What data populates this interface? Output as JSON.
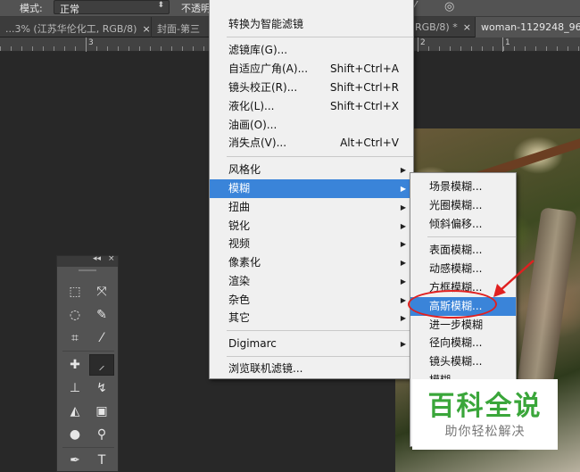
{
  "options_bar": {
    "mode_label": "模式:",
    "mode_value": "正常",
    "opacity_label": "不透明"
  },
  "tabs": [
    {
      "label": "...3% (江苏华伦化工, RGB/8)",
      "close": "×"
    },
    {
      "label": "封面-第三",
      "close": ""
    },
    {
      "label": "RGB/8) *",
      "close": "×"
    },
    {
      "label": "woman-1129248_96",
      "close": ""
    }
  ],
  "ruler": {
    "numbers": [
      "3",
      "2",
      "1"
    ]
  },
  "filter_menu": {
    "items": [
      {
        "label": "转换为智能滤镜",
        "shortcut": "",
        "submenu": false
      },
      {
        "label": "滤镜库(G)...",
        "shortcut": "",
        "submenu": false
      },
      {
        "label": "自适应广角(A)...",
        "shortcut": "Shift+Ctrl+A",
        "submenu": false
      },
      {
        "label": "镜头校正(R)...",
        "shortcut": "Shift+Ctrl+R",
        "submenu": false
      },
      {
        "label": "液化(L)...",
        "shortcut": "Shift+Ctrl+X",
        "submenu": false
      },
      {
        "label": "油画(O)...",
        "shortcut": "",
        "submenu": false
      },
      {
        "label": "消失点(V)...",
        "shortcut": "Alt+Ctrl+V",
        "submenu": false
      },
      {
        "label": "风格化",
        "shortcut": "",
        "submenu": true
      },
      {
        "label": "模糊",
        "shortcut": "",
        "submenu": true,
        "highlighted": true
      },
      {
        "label": "扭曲",
        "shortcut": "",
        "submenu": true
      },
      {
        "label": "锐化",
        "shortcut": "",
        "submenu": true
      },
      {
        "label": "视频",
        "shortcut": "",
        "submenu": true
      },
      {
        "label": "像素化",
        "shortcut": "",
        "submenu": true
      },
      {
        "label": "渲染",
        "shortcut": "",
        "submenu": true
      },
      {
        "label": "杂色",
        "shortcut": "",
        "submenu": true
      },
      {
        "label": "其它",
        "shortcut": "",
        "submenu": true
      },
      {
        "label": "Digimarc",
        "shortcut": "",
        "submenu": true
      },
      {
        "label": "浏览联机滤镜...",
        "shortcut": "",
        "submenu": false
      }
    ]
  },
  "blur_submenu": {
    "items": [
      {
        "label": "场景模糊..."
      },
      {
        "label": "光圈模糊..."
      },
      {
        "label": "倾斜偏移..."
      },
      {
        "label": "表面模糊..."
      },
      {
        "label": "动感模糊..."
      },
      {
        "label": "方框模糊..."
      },
      {
        "label": "高斯模糊...",
        "highlighted": true
      },
      {
        "label": "进一步模糊"
      },
      {
        "label": "径向模糊..."
      },
      {
        "label": "镜头模糊..."
      },
      {
        "label": "模糊"
      }
    ]
  },
  "toolbox": {
    "collapse": "◂◂",
    "close": "×",
    "tools": [
      "rect-marquee-icon",
      "move-icon",
      "lasso-icon",
      "quick-select-icon",
      "crop-icon",
      "eyedropper-icon",
      "healing-icon",
      "brush-icon",
      "stamp-icon",
      "history-brush-icon",
      "eraser-icon",
      "gradient-icon",
      "blur-icon",
      "dodge-icon",
      "pen-icon",
      "text-icon"
    ]
  },
  "watermark": {
    "main": "百科全说",
    "sub": "助你轻松解决"
  },
  "colors": {
    "menu_highlight": "#3a84d9",
    "annotation_red": "#e02020",
    "watermark_green": "#3aa63a"
  }
}
